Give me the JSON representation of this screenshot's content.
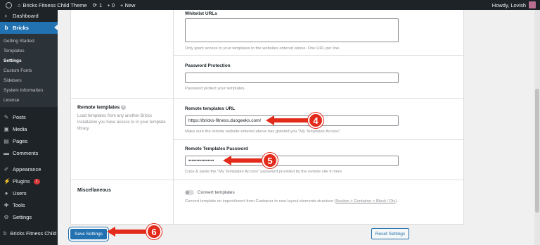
{
  "adminbar": {
    "site_name": "Bricks Fitness Child Theme",
    "updates_count": "1",
    "comments_count": "0",
    "new_label": "+ New",
    "howdy": "Howdy, Lovish"
  },
  "sidebar": {
    "dashboard": "Dashboard",
    "bricks": "Bricks",
    "bricks_sub": [
      "Getting Started",
      "Templates",
      "Settings",
      "Custom Fonts",
      "Sidebars",
      "System Information",
      "License"
    ],
    "posts": "Posts",
    "media": "Media",
    "pages": "Pages",
    "comments": "Comments",
    "appearance": "Appearance",
    "plugins": "Plugins",
    "plugins_badge": "1",
    "users": "Users",
    "tools": "Tools",
    "settings": "Settings",
    "bricks_fitness": "Bricks Fitness Child Theme"
  },
  "form": {
    "whitelist_label": "Whitelist URLs",
    "whitelist_desc": "Only grant access to your templates to the websites entered above. One URL per line.",
    "password_protection_label": "Password Protection",
    "password_protection_desc": "Password protect your templates.",
    "remote_templates_label": "Remote templates",
    "remote_templates_desc": "Load templates from any another Bricks installation you have access to in your template library.",
    "remote_url_label": "Remote templates URL",
    "remote_url_value": "https://bricks-fitness.duogeeks.com/",
    "remote_url_desc": "Make sure the remote website entered above has granted you \"My Templates Access\".",
    "remote_password_label": "Remote Templates Password",
    "remote_password_value": "••••••••••••••••",
    "remote_password_desc": "Copy & paste the \"My Templates Access\" password provided by the remote site in here.",
    "misc_label": "Miscellaneous",
    "convert_label": "Convert templates",
    "convert_desc_prefix": "Convert template on import/insert from Container to new layout elements structure (",
    "convert_desc_link": "Section > Container > Block / Div",
    "convert_desc_suffix": ")."
  },
  "buttons": {
    "save": "Save Settings",
    "reset": "Reset Settings"
  },
  "callouts": [
    "4",
    "5",
    "6"
  ],
  "colors": {
    "accent": "#2271b1",
    "callout": "#e32b1b",
    "sidebar_bg": "#1d2327"
  }
}
